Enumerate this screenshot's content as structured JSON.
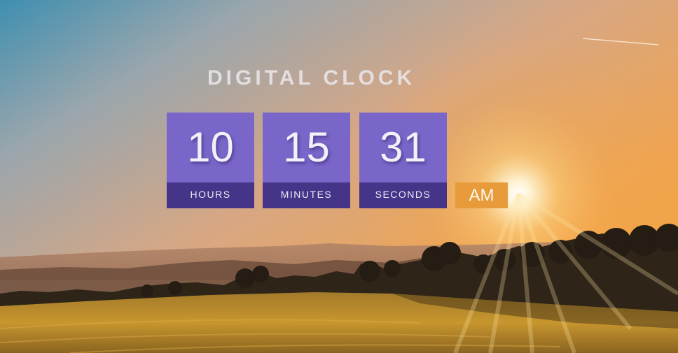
{
  "page": {
    "title": "DIGITAL CLOCK"
  },
  "clock": {
    "hours": "10",
    "hours_label": "HOURS",
    "minutes": "15",
    "minutes_label": "MINUTES",
    "seconds": "31",
    "seconds_label": "SECONDS",
    "period": "AM"
  },
  "colors": {
    "digit_tile": "#7a66c8",
    "label_bar": "#463489",
    "period_badge": "#e79b3a"
  },
  "background": {
    "scene": "sunset over hills and golden field"
  }
}
